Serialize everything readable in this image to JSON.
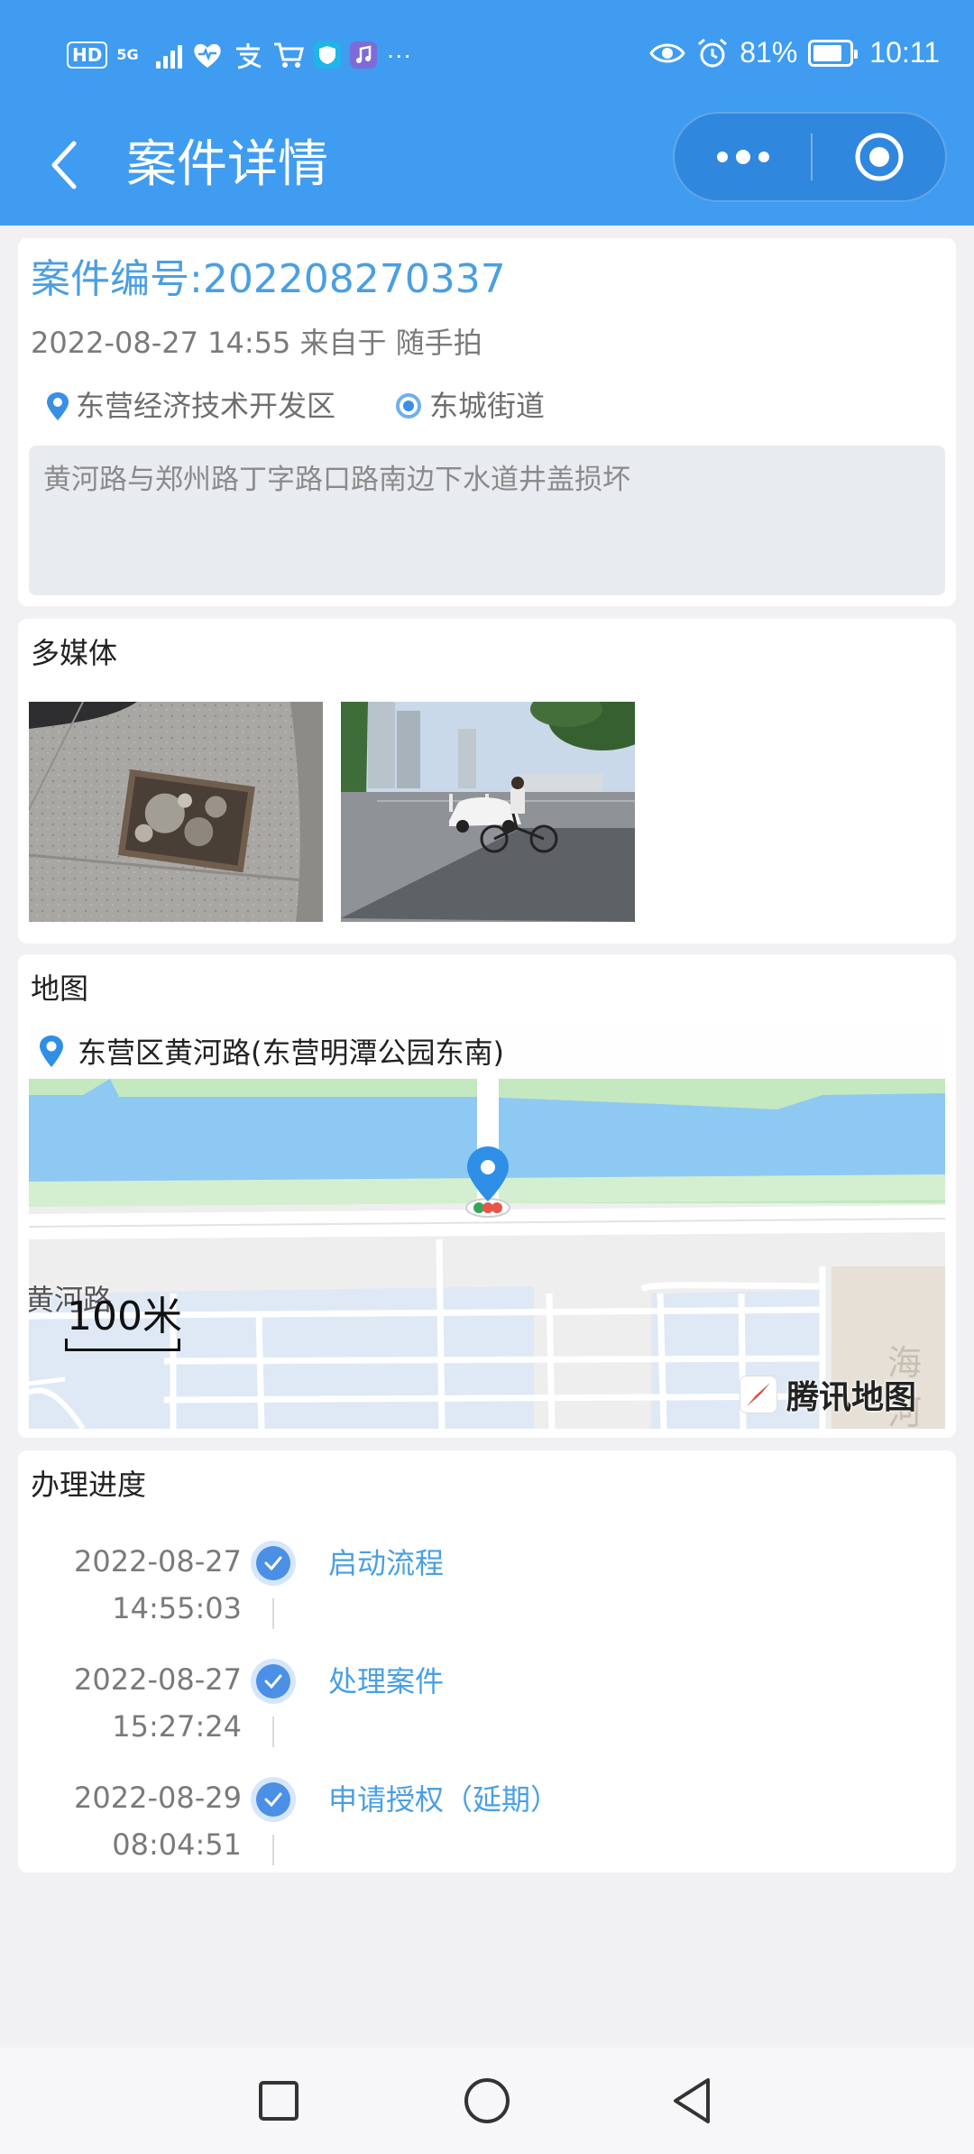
{
  "status_bar": {
    "hd": "HD",
    "network": "5G",
    "more": "···",
    "battery_percent": "81%",
    "battery_level": 0.81,
    "time": "10:11"
  },
  "nav": {
    "title": "案件详情"
  },
  "case": {
    "number": "案件编号:202208270337",
    "meta": "2022-08-27 14:55 来自于 随手拍",
    "district": "东营经济技术开发区",
    "street": "东城街道",
    "description": "黄河路与郑州路丁字路口路南边下水道井盖损坏"
  },
  "media": {
    "title": "多媒体"
  },
  "map": {
    "title": "地图",
    "address": "东营区黄河路(东营明潭公园东南)",
    "road_label": "黄河路",
    "scale": "100米",
    "sea_label": "海河",
    "logo": "腾讯地图"
  },
  "progress": {
    "title": "办理进度",
    "steps": [
      {
        "date": "2022-08-27",
        "time": "14:55:03",
        "label": "启动流程"
      },
      {
        "date": "2022-08-27",
        "time": "15:27:24",
        "label": "处理案件"
      },
      {
        "date": "2022-08-29",
        "time": "08:04:51",
        "label": "申请授权（延期）"
      }
    ]
  },
  "colors": {
    "header": "#3f9cf0",
    "accent": "#4a9fe3",
    "page_bg": "#f1f1f3"
  }
}
